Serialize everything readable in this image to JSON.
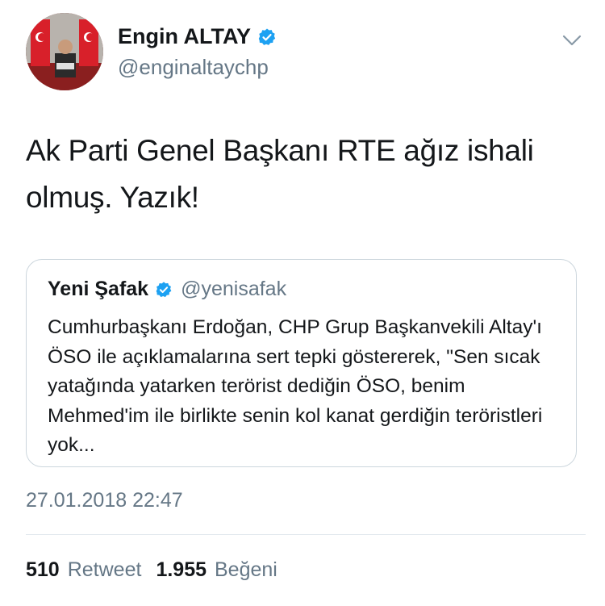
{
  "author": {
    "name": "Engin ALTAY",
    "handle": "@enginaltaychp"
  },
  "tweet": {
    "text": "Ak Parti Genel Başkanı RTE ağız ishali olmuş. Yazık!"
  },
  "quoted_tweet": {
    "name": "Yeni Şafak",
    "handle": "@yenisafak",
    "text": "Cumhurbaşkanı Erdoğan, CHP Grup Başkanvekili Altay'ı ÖSO ile açıklamalarına sert tepki göstererek, \"Sen sıcak yatağında yatarken terörist dediğin ÖSO, benim Mehmed'im ile birlikte senin kol kanat gerdiğin teröristleri yok..."
  },
  "timestamp": "27.01.2018 22:47",
  "stats": {
    "retweet_count": "510",
    "retweet_label": "Retweet",
    "like_count": "1.955",
    "like_label": "Beğeni"
  },
  "colors": {
    "verified": "#1da1f2",
    "secondary_text": "#657786",
    "border": "#ccd6dd"
  },
  "icons": {
    "verified": "verified-badge-icon",
    "more": "chevron-down-icon"
  }
}
